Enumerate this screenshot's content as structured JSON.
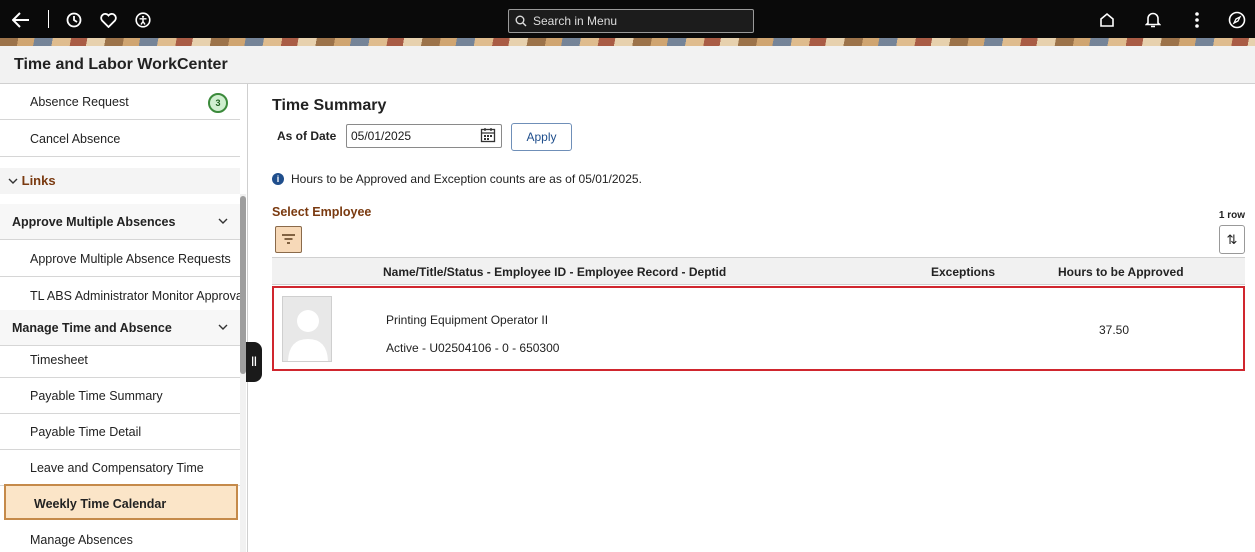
{
  "topbar": {
    "search_placeholder": "Search in Menu",
    "icons": [
      "back-arrow-icon",
      "recent-history-icon",
      "favorites-heart-icon",
      "accessibility-icon",
      "home-icon",
      "notifications-bell-icon",
      "more-actions-icon",
      "navigator-compass-icon"
    ]
  },
  "page_title": "Time and Labor WorkCenter",
  "sidebar": {
    "items_top": [
      {
        "label": "Absence Request",
        "badge": "3"
      },
      {
        "label": "Cancel Absence"
      }
    ],
    "links_header": "Links",
    "groups": [
      {
        "label": "Approve Multiple Absences",
        "items": [
          "Approve Multiple Absence Requests",
          "TL ABS Administrator Monitor Approva"
        ]
      },
      {
        "label": "Manage Time and Absence",
        "items": [
          "Timesheet",
          "Payable Time Summary",
          "Payable Time Detail",
          "Leave and Compensatory Time",
          "Weekly Time Calendar",
          "Manage Absences"
        ]
      }
    ],
    "selected_item": "Weekly Time Calendar"
  },
  "main": {
    "heading": "Time Summary",
    "as_of_label": "As of Date",
    "as_of_value": "05/01/2025",
    "apply_label": "Apply",
    "info_message": "Hours to be Approved and Exception counts are as of 05/01/2025.",
    "select_employee_label": "Select Employee",
    "row_count": "1 row",
    "columns": {
      "name": "Name/Title/Status - Employee ID - Employee Record - Deptid",
      "exceptions": "Exceptions",
      "hours": "Hours to be Approved"
    },
    "rows": [
      {
        "title": "Printing Equipment Operator II",
        "detail": "Active - U02504106 - 0 - 650300",
        "exceptions": "",
        "hours": "37.50"
      }
    ]
  },
  "colors": {
    "accent_brown": "#7a3a10",
    "selected_bg": "#fbe5c8",
    "highlight_border": "#d0262e",
    "badge_green": "#3b8a3b"
  }
}
